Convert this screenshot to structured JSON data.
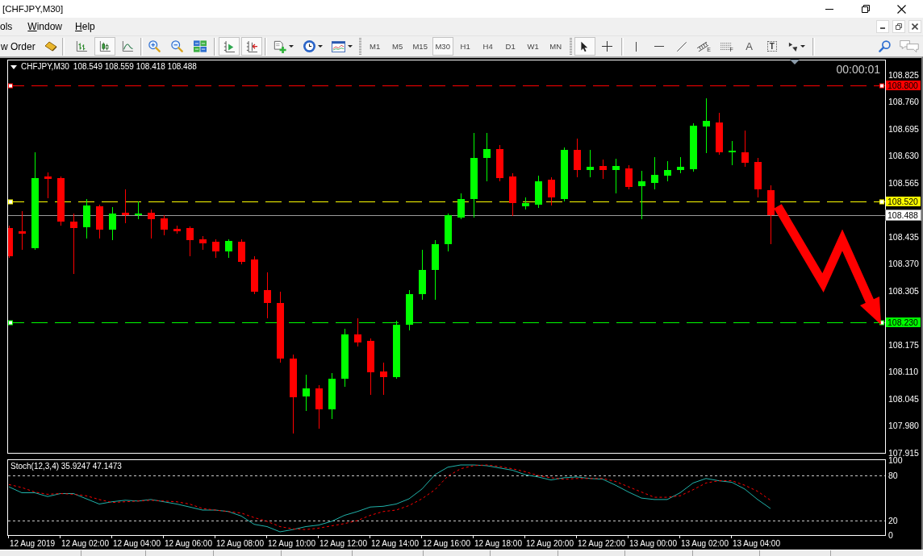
{
  "window": {
    "title": "[CHFJPY,M30]"
  },
  "menu": [
    {
      "label": "ols",
      "mnemonic": false
    },
    {
      "label": "Window",
      "mnemonic": true
    },
    {
      "label": "Help",
      "mnemonic": true
    }
  ],
  "toolbar": {
    "new_order": "w Order",
    "chart_types": [
      {
        "selected": false
      },
      {
        "selected": true
      },
      {
        "selected": false
      }
    ],
    "auto_scroll": {
      "on": true
    },
    "chart_shift": {
      "on": true
    },
    "timeframes": [
      {
        "label": "M1",
        "selected": false
      },
      {
        "label": "M5",
        "selected": false
      },
      {
        "label": "M15",
        "selected": false
      },
      {
        "label": "M30",
        "selected": true
      },
      {
        "label": "H1",
        "selected": false
      },
      {
        "label": "H4",
        "selected": false
      },
      {
        "label": "D1",
        "selected": false
      },
      {
        "label": "W1",
        "selected": false
      },
      {
        "label": "MN",
        "selected": false
      }
    ],
    "cursor_modes": [
      {
        "selected": true
      },
      {
        "selected": false
      }
    ],
    "channel_letter": "E",
    "fibo_letter": "F",
    "text_tool": "A",
    "label_tool": "T"
  },
  "chart": {
    "symbol": "CHFJPY,M30",
    "quote": "108.549 108.559 108.418 108.488",
    "countdown": "00:00:01",
    "price_axis": [
      "108.825",
      "108.760",
      "108.695",
      "108.630",
      "108.565",
      "108.435",
      "108.370",
      "108.305",
      "108.175",
      "108.110",
      "108.045",
      "107.980",
      "107.915"
    ],
    "levels": [
      {
        "tag": "108.800",
        "color": "#ff0000",
        "kind": "dashed"
      },
      {
        "tag": "108.520",
        "color": "#ffff00",
        "kind": "dashed"
      },
      {
        "tag": "108.488",
        "color": "#ffffff",
        "kind": "bid"
      },
      {
        "tag": "108.230",
        "color": "#00ff00",
        "kind": "dashed"
      }
    ],
    "indicator": {
      "title": "Stoch(12,3,4) 35.9247 47.1473",
      "chart_data": {
        "type": "line",
        "ylim": [
          0,
          100
        ],
        "yticks": [
          {
            "value": 100,
            "label": "100"
          },
          {
            "value": 80,
            "label": "80"
          },
          {
            "value": 20,
            "label": "20"
          },
          {
            "value": 0,
            "label": "0"
          }
        ],
        "ref_lines": [
          {
            "axis": "y",
            "value": 80
          },
          {
            "axis": "y",
            "value": 20
          }
        ],
        "series": [
          {
            "color": "#20b2aa",
            "line_style": "solid",
            "values": [
              65,
              57,
              57,
              52,
              56,
              56,
              49,
              42,
              45,
              47,
              46,
              48,
              45,
              42,
              38,
              34,
              34,
              32,
              26,
              15,
              12,
              5,
              8,
              12,
              14,
              19,
              27,
              32,
              38,
              39,
              42,
              49,
              62,
              81,
              91,
              94,
              94,
              93,
              90,
              87,
              81,
              78,
              74,
              77,
              78,
              76,
              75,
              67,
              58,
              50,
              48,
              48,
              57,
              70,
              76,
              73,
              71,
              62,
              48,
              36
            ]
          },
          {
            "color": "#ff0000",
            "line_style": "dashed",
            "values": [
              68,
              64,
              58,
              55,
              56,
              55,
              53,
              48,
              44,
              45,
              46,
              47,
              46,
              45,
              42,
              36,
              34,
              32,
              30,
              24,
              19,
              12,
              9,
              8,
              10,
              13,
              16,
              20,
              27,
              32,
              34,
              40,
              49,
              61,
              79,
              89,
              93,
              94,
              92,
              89,
              85,
              80,
              77,
              75,
              76,
              76,
              76,
              72,
              65,
              58,
              51,
              51,
              53,
              61,
              70,
              73,
              73,
              67,
              59,
              47
            ]
          }
        ]
      }
    },
    "time_axis": [
      "12 Aug 2019",
      "12 Aug 02:00",
      "12 Aug 04:00",
      "12 Aug 06:00",
      "12 Aug 08:00",
      "12 Aug 10:00",
      "12 Aug 12:00",
      "12 Aug 14:00",
      "12 Aug 16:00",
      "12 Aug 18:00",
      "12 Aug 20:00",
      "12 Aug 22:00",
      "13 Aug 00:00",
      "13 Aug 02:00",
      "13 Aug 04:00"
    ]
  }
}
